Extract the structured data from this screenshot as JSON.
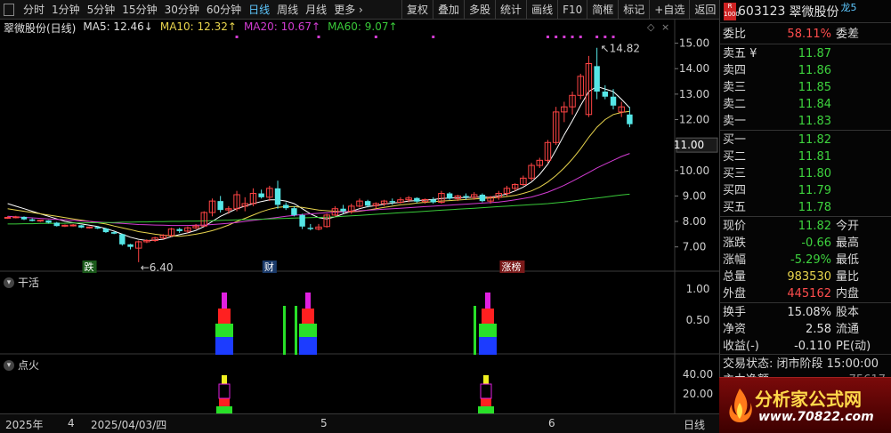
{
  "toolbar": {
    "periods": [
      "分时",
      "1分钟",
      "5分钟",
      "15分钟",
      "30分钟",
      "60分钟",
      "日线",
      "周线",
      "月线",
      "更多 ›"
    ],
    "active_period": "日线",
    "buttons": [
      "复权",
      "叠加",
      "多股",
      "统计",
      "画线",
      "F10",
      "简框",
      "标记",
      "+自选",
      "返回"
    ]
  },
  "chart_header": {
    "name": "翠微股份(日线)",
    "ma5": "MA5: 12.46↓",
    "ma10": "MA10: 12.32↑",
    "ma20": "MA20: 10.67↑",
    "ma60": "MA60: 9.07↑"
  },
  "colors": {
    "up": "#ff4444",
    "down": "#55e6e6",
    "ma5": "#ffffff",
    "ma10": "#e8d44d",
    "ma20": "#d23cd2",
    "ma60": "#39c939",
    "background": "#000000"
  },
  "price_axis": {
    "labels": [
      "15.00",
      "14.00",
      "13.00",
      "12.00",
      "11.00",
      "10.00",
      "9.00",
      "8.00",
      "7.00"
    ],
    "current": "11.00"
  },
  "annotations": {
    "high_label": "14.82",
    "low_label": "6.40",
    "tag_die": "跌",
    "tag_cai": "财",
    "tag_zhangbang": "涨榜"
  },
  "chart_data": {
    "type": "candlestick",
    "series_ohlc": [
      [
        8.15,
        8.2,
        8.1,
        8.16
      ],
      [
        8.16,
        8.22,
        8.12,
        8.18
      ],
      [
        8.18,
        8.2,
        8.05,
        8.08
      ],
      [
        8.08,
        8.12,
        8.0,
        8.02
      ],
      [
        8.02,
        8.06,
        7.98,
        8.05
      ],
      [
        8.04,
        8.05,
        7.92,
        7.95
      ],
      [
        7.95,
        7.98,
        7.8,
        7.82
      ],
      [
        7.82,
        7.88,
        7.78,
        7.85
      ],
      [
        7.85,
        7.9,
        7.8,
        7.86
      ],
      [
        7.85,
        7.86,
        7.74,
        7.76
      ],
      [
        7.76,
        7.8,
        7.72,
        7.78
      ],
      [
        7.78,
        7.82,
        7.7,
        7.72
      ],
      [
        7.72,
        7.75,
        7.55,
        7.58
      ],
      [
        7.58,
        7.62,
        7.5,
        7.52
      ],
      [
        7.5,
        7.52,
        7.05,
        7.1
      ],
      [
        7.1,
        7.12,
        6.9,
        7.0
      ],
      [
        6.95,
        7.25,
        6.4,
        7.2
      ],
      [
        7.2,
        7.3,
        7.15,
        7.25
      ],
      [
        7.25,
        7.4,
        7.2,
        7.35
      ],
      [
        7.35,
        7.5,
        7.3,
        7.45
      ],
      [
        7.45,
        7.75,
        7.4,
        7.7
      ],
      [
        7.7,
        7.75,
        7.55,
        7.62
      ],
      [
        7.62,
        7.8,
        7.55,
        7.75
      ],
      [
        7.75,
        7.9,
        7.7,
        7.82
      ],
      [
        7.82,
        8.4,
        7.8,
        8.35
      ],
      [
        8.35,
        8.9,
        8.2,
        8.8
      ],
      [
        8.8,
        9.0,
        8.35,
        8.45
      ],
      [
        8.45,
        8.6,
        8.3,
        8.5
      ],
      [
        8.5,
        9.2,
        8.4,
        9.05
      ],
      [
        8.6,
        8.95,
        8.4,
        8.7
      ],
      [
        8.7,
        9.3,
        8.6,
        9.1
      ],
      [
        9.1,
        9.25,
        8.9,
        8.95
      ],
      [
        8.95,
        9.4,
        8.8,
        9.3
      ],
      [
        9.3,
        9.6,
        8.5,
        8.65
      ],
      [
        8.65,
        8.75,
        8.45,
        8.52
      ],
      [
        8.52,
        8.6,
        8.2,
        8.25
      ],
      [
        8.25,
        8.3,
        7.7,
        7.8
      ],
      [
        7.75,
        7.9,
        7.65,
        7.7
      ],
      [
        7.7,
        7.9,
        7.65,
        7.78
      ],
      [
        7.8,
        8.3,
        7.75,
        8.25
      ],
      [
        8.25,
        8.6,
        8.2,
        8.5
      ],
      [
        8.5,
        8.65,
        8.3,
        8.4
      ],
      [
        8.4,
        8.7,
        8.3,
        8.6
      ],
      [
        8.6,
        8.9,
        8.55,
        8.8
      ],
      [
        8.8,
        8.85,
        8.55,
        8.62
      ],
      [
        8.62,
        8.75,
        8.5,
        8.7
      ],
      [
        8.7,
        8.85,
        8.6,
        8.8
      ],
      [
        8.8,
        8.9,
        8.65,
        8.75
      ],
      [
        8.75,
        8.95,
        8.7,
        8.85
      ],
      [
        8.85,
        9.0,
        8.75,
        8.92
      ],
      [
        8.92,
        8.95,
        8.72,
        8.78
      ],
      [
        8.78,
        8.9,
        8.7,
        8.86
      ],
      [
        8.86,
        8.95,
        8.7,
        8.75
      ],
      [
        8.75,
        9.2,
        8.7,
        9.1
      ],
      [
        9.1,
        9.15,
        8.85,
        8.9
      ],
      [
        8.9,
        9.05,
        8.8,
        9.0
      ],
      [
        9.0,
        9.1,
        8.85,
        8.95
      ],
      [
        8.95,
        9.15,
        8.85,
        9.05
      ],
      [
        9.05,
        9.1,
        8.75,
        8.8
      ],
      [
        8.8,
        9.0,
        8.7,
        8.95
      ],
      [
        8.95,
        9.2,
        8.85,
        9.1
      ],
      [
        9.1,
        9.4,
        9.0,
        9.3
      ],
      [
        9.3,
        9.5,
        9.2,
        9.45
      ],
      [
        9.45,
        9.8,
        9.4,
        9.7
      ],
      [
        9.7,
        10.3,
        9.6,
        10.2
      ],
      [
        10.2,
        10.5,
        10.1,
        10.4
      ],
      [
        10.4,
        11.2,
        10.3,
        11.1
      ],
      [
        11.1,
        12.5,
        11.0,
        12.3
      ],
      [
        12.3,
        12.7,
        11.9,
        12.5
      ],
      [
        12.5,
        13.1,
        12.2,
        12.95
      ],
      [
        12.95,
        13.8,
        12.8,
        13.7
      ],
      [
        12.2,
        14.5,
        12.1,
        14.2
      ],
      [
        14.1,
        14.82,
        12.8,
        13.1
      ],
      [
        13.1,
        13.35,
        12.8,
        12.9
      ],
      [
        12.9,
        13.2,
        12.4,
        12.55
      ],
      [
        12.3,
        12.7,
        12.1,
        12.5
      ],
      [
        12.2,
        12.5,
        11.7,
        11.82
      ]
    ],
    "ma_series": [
      {
        "name": "MA5",
        "values": [
          8.7,
          8.6,
          8.5,
          8.4,
          8.3,
          8.2,
          8.1,
          8.0,
          7.95,
          7.9,
          7.85,
          7.8,
          7.72,
          7.62,
          7.5,
          7.38,
          7.3,
          7.25,
          7.27,
          7.3,
          7.4,
          7.48,
          7.55,
          7.65,
          7.8,
          8.0,
          8.2,
          8.35,
          8.5,
          8.6,
          8.7,
          8.78,
          8.85,
          8.85,
          8.8,
          8.7,
          8.5,
          8.3,
          8.15,
          8.1,
          8.18,
          8.3,
          8.4,
          8.5,
          8.58,
          8.62,
          8.68,
          8.72,
          8.75,
          8.8,
          8.82,
          8.84,
          8.86,
          8.9,
          8.92,
          8.93,
          8.94,
          8.95,
          8.95,
          8.96,
          9.0,
          9.08,
          9.2,
          9.35,
          9.55,
          9.85,
          10.25,
          10.8,
          11.4,
          11.95,
          12.55,
          13.1,
          13.3,
          13.2,
          13.1,
          12.8,
          12.46
        ]
      },
      {
        "name": "MA10",
        "values": [
          8.5,
          8.45,
          8.4,
          8.35,
          8.3,
          8.25,
          8.2,
          8.15,
          8.1,
          8.05,
          8.0,
          7.95,
          7.9,
          7.82,
          7.75,
          7.68,
          7.6,
          7.55,
          7.5,
          7.46,
          7.43,
          7.42,
          7.45,
          7.5,
          7.56,
          7.64,
          7.74,
          7.86,
          8.0,
          8.12,
          8.25,
          8.38,
          8.48,
          8.55,
          8.58,
          8.58,
          8.55,
          8.5,
          8.45,
          8.42,
          8.4,
          8.38,
          8.38,
          8.4,
          8.45,
          8.5,
          8.55,
          8.6,
          8.65,
          8.68,
          8.72,
          8.75,
          8.78,
          8.8,
          8.82,
          8.84,
          8.86,
          8.88,
          8.9,
          8.92,
          8.94,
          8.98,
          9.02,
          9.1,
          9.2,
          9.35,
          9.55,
          9.8,
          10.1,
          10.45,
          10.85,
          11.3,
          11.7,
          12.0,
          12.2,
          12.28,
          12.32
        ]
      },
      {
        "name": "MA20",
        "values": [
          8.2,
          8.18,
          8.16,
          8.14,
          8.12,
          8.1,
          8.08,
          8.06,
          8.04,
          8.02,
          8.0,
          7.98,
          7.96,
          7.94,
          7.92,
          7.9,
          7.88,
          7.87,
          7.86,
          7.85,
          7.84,
          7.84,
          7.84,
          7.85,
          7.86,
          7.88,
          7.9,
          7.93,
          7.96,
          8.0,
          8.04,
          8.08,
          8.12,
          8.16,
          8.2,
          8.24,
          8.27,
          8.3,
          8.32,
          8.34,
          8.36,
          8.38,
          8.4,
          8.42,
          8.44,
          8.46,
          8.48,
          8.5,
          8.52,
          8.54,
          8.56,
          8.58,
          8.6,
          8.62,
          8.64,
          8.66,
          8.68,
          8.7,
          8.72,
          8.74,
          8.76,
          8.8,
          8.85,
          8.9,
          8.96,
          9.05,
          9.15,
          9.28,
          9.42,
          9.58,
          9.75,
          9.92,
          10.1,
          10.25,
          10.4,
          10.55,
          10.67
        ]
      },
      {
        "name": "MA60",
        "values": [
          7.9,
          7.9,
          7.91,
          7.91,
          7.92,
          7.92,
          7.93,
          7.93,
          7.94,
          7.94,
          7.95,
          7.95,
          7.96,
          7.96,
          7.97,
          7.97,
          7.98,
          7.98,
          7.99,
          7.99,
          8.0,
          8.0,
          8.01,
          8.01,
          8.02,
          8.03,
          8.04,
          8.05,
          8.06,
          8.07,
          8.08,
          8.09,
          8.1,
          8.11,
          8.12,
          8.13,
          8.14,
          8.15,
          8.16,
          8.17,
          8.18,
          8.2,
          8.22,
          8.24,
          8.26,
          8.28,
          8.3,
          8.32,
          8.34,
          8.36,
          8.38,
          8.4,
          8.42,
          8.44,
          8.46,
          8.48,
          8.5,
          8.52,
          8.54,
          8.56,
          8.58,
          8.6,
          8.62,
          8.64,
          8.66,
          8.68,
          8.7,
          8.73,
          8.76,
          8.8,
          8.84,
          8.88,
          8.92,
          8.96,
          9.0,
          9.04,
          9.07
        ]
      }
    ],
    "y_range": [
      6.5,
      15.3
    ]
  },
  "sub1": {
    "title": "干活",
    "axis": [
      "1.00",
      "0.50"
    ]
  },
  "sub2": {
    "title": "点火",
    "axis": [
      "40.00",
      "20.00"
    ]
  },
  "time_axis": {
    "labels": [
      "2025年",
      "4",
      "2025/04/03/四",
      "5",
      "6",
      "日线"
    ]
  },
  "quote": {
    "badge_top": "R",
    "badge_bottom": "1000",
    "code": "603123",
    "name": "翠微股份",
    "tag": "龙5",
    "weibi_label": "委比",
    "weibi_value": "58.11%",
    "weicha_label": "委差",
    "sells": [
      {
        "label": "卖五 ¥",
        "price": "11.87"
      },
      {
        "label": "卖四",
        "price": "11.86"
      },
      {
        "label": "卖三",
        "price": "11.85"
      },
      {
        "label": "卖二",
        "price": "11.84"
      },
      {
        "label": "卖一",
        "price": "11.83"
      }
    ],
    "buys": [
      {
        "label": "买一",
        "price": "11.82"
      },
      {
        "label": "买二",
        "price": "11.81"
      },
      {
        "label": "买三",
        "price": "11.80"
      },
      {
        "label": "买四",
        "price": "11.79"
      },
      {
        "label": "买五",
        "price": "11.78"
      }
    ],
    "stats": [
      {
        "label": "现价",
        "value": "11.82",
        "label2": "今开"
      },
      {
        "label": "涨跌",
        "value": "-0.66",
        "label2": "最高"
      },
      {
        "label": "涨幅",
        "value": "-5.29%",
        "label2": "最低"
      },
      {
        "label": "总量",
        "value": "983530",
        "label2": "量比"
      },
      {
        "label": "外盘",
        "value": "445162",
        "label2": "内盘"
      }
    ],
    "stats2": [
      {
        "label": "换手",
        "value": "15.08%",
        "label2": "股本"
      },
      {
        "label": "净资",
        "value": "2.58",
        "label2": "流通"
      },
      {
        "label": "收益(-)",
        "value": "-0.110",
        "label2": "PE(动)"
      }
    ],
    "trade_status": "交易状态: 闭市阶段 15:00:00",
    "partial_row": "主力净额",
    "partial_value": "75617"
  },
  "watermark": {
    "text": "分析家公式网",
    "url": "www.70822.com"
  }
}
